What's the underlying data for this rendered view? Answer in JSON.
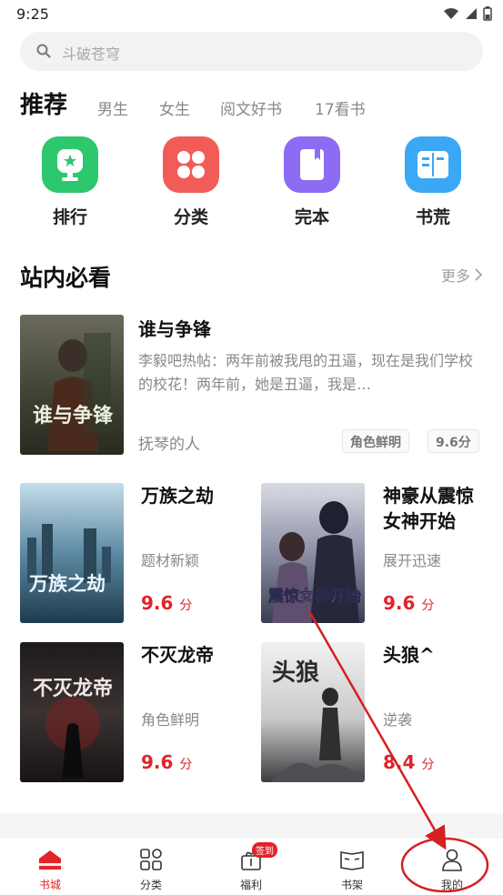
{
  "status": {
    "time": "9:25"
  },
  "search": {
    "placeholder": "斗破苍穹"
  },
  "tabs": [
    {
      "label": "推荐"
    },
    {
      "label": "男生"
    },
    {
      "label": "女生"
    },
    {
      "label": "阅文好书"
    },
    {
      "label": "17看书"
    }
  ],
  "quick_links": [
    {
      "label": "排行",
      "icon": "trophy-icon",
      "color": "#2dc76d"
    },
    {
      "label": "分类",
      "icon": "grid-icon",
      "color": "#f25c58"
    },
    {
      "label": "完本",
      "icon": "book-icon",
      "color": "#8c6cf2"
    },
    {
      "label": "书荒",
      "icon": "open-book-icon",
      "color": "#3aa8f4"
    }
  ],
  "section": {
    "title": "站内必看",
    "more": "更多"
  },
  "featured": {
    "title": "谁与争锋",
    "desc": "李毅吧热帖：两年前被我甩的丑逼，现在是我们学校的校花！两年前，她是丑逼，我是…",
    "author": "抚琴的人",
    "tags": [
      "角色鲜明",
      "9.6分"
    ],
    "cover_text": "谁与争锋"
  },
  "books": [
    {
      "title": "万族之劫",
      "desc": "题材新颖",
      "score": "9.6",
      "unit": "分",
      "cover_text": "万族之劫"
    },
    {
      "title": "神豪从震惊女神开始",
      "desc": "展开迅速",
      "score": "9.6",
      "unit": "分",
      "cover_text": "震惊女神开始"
    },
    {
      "title": "不灭龙帝",
      "desc": "角色鲜明",
      "score": "9.6",
      "unit": "分",
      "cover_text": "不灭龙帝"
    },
    {
      "title": "头狼^",
      "desc": "逆袭",
      "score": "8.4",
      "unit": "分",
      "cover_text": "头狼"
    }
  ],
  "nav": [
    {
      "label": "书城",
      "icon": "home-icon"
    },
    {
      "label": "分类",
      "icon": "category-icon"
    },
    {
      "label": "福利",
      "icon": "gift-icon",
      "badge": "签到"
    },
    {
      "label": "书架",
      "icon": "bookshelf-icon"
    },
    {
      "label": "我的",
      "icon": "user-icon"
    }
  ],
  "colors": {
    "accent": "#e0242a",
    "annotation": "#d42020"
  }
}
